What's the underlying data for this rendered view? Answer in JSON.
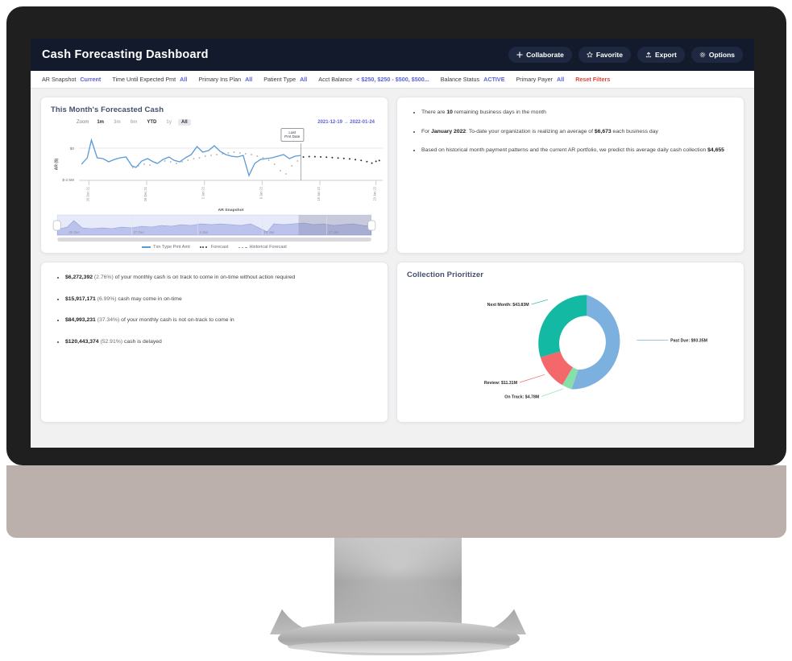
{
  "header": {
    "title": "Cash Forecasting Dashboard",
    "actions": [
      {
        "label": "Collaborate",
        "icon": "plus-icon"
      },
      {
        "label": "Favorite",
        "icon": "star-icon"
      },
      {
        "label": "Export",
        "icon": "upload-icon"
      },
      {
        "label": "Options",
        "icon": "gear-icon"
      }
    ]
  },
  "filters": [
    {
      "label": "AR Snapshot",
      "value": "Current"
    },
    {
      "label": "Time Until Expected Pmt",
      "value": "All"
    },
    {
      "label": "Primary Ins Plan",
      "value": "All"
    },
    {
      "label": "Patient Type",
      "value": "All"
    },
    {
      "label": "Acct Balance",
      "value": "< $250, $250 - $500, $500..."
    },
    {
      "label": "Balance Status",
      "value": "ACTIVE"
    },
    {
      "label": "Primary Payer",
      "value": "All"
    }
  ],
  "reset_filters": "Reset Filters",
  "forecast_card": {
    "title": "This Month's Forecasted Cash",
    "zoom_label": "Zoom",
    "zoom_options": [
      "1m",
      "3m",
      "6m",
      "YTD",
      "1y",
      "All"
    ],
    "zoom_selected": "All",
    "zoom_enabled": [
      "1m",
      "YTD",
      "All"
    ],
    "date_from": "2021-12-19",
    "date_to": "2022-01-24",
    "date_arrow": "→",
    "annotation": "Last\nPmt Date",
    "annotation_line1": "Last",
    "annotation_line2": "Pmt Date",
    "legend": [
      {
        "label": "Txn Type Pmt Amt",
        "style": "line",
        "color": "#5b9bd5"
      },
      {
        "label": "Forecast",
        "style": "dotted",
        "color": "#333333"
      },
      {
        "label": "Historical Forecast",
        "style": "dashed",
        "color": "#9a9aa2"
      }
    ],
    "navigator_ticks": [
      "20 Dec",
      "27 Dec",
      "3 Jan",
      "10 Jan",
      "17 Jan"
    ]
  },
  "chart_data": [
    {
      "type": "line",
      "title": "This Month's Forecasted Cash",
      "xlabel": "AR Snapshot",
      "ylabel": "AR ($)",
      "ytick_labels": [
        "$0",
        "$-2.5M"
      ],
      "ytick_values": [
        0,
        -2500000
      ],
      "ylim": [
        -3000000,
        1200000
      ],
      "xtick_labels": [
        "19 Dec 21",
        "26 Dec 21",
        "2 Jan 22",
        "9 Jan 22",
        "16 Jan 22",
        "23 Jan 22"
      ],
      "grid": false,
      "legend_position": "bottom",
      "annotation": "Last Pmt Date",
      "series": [
        {
          "name": "Txn Type Pmt Amt",
          "style": "line",
          "color": "#5b9bd5",
          "values": [
            -1450000,
            -150000,
            800000,
            -480000,
            -560000,
            -900000,
            -620000,
            -380000,
            -260000,
            -1100000,
            -1250000,
            -700000,
            -480000,
            -800000,
            -1000000,
            -520000,
            -320000,
            -600000,
            -700000,
            -380000,
            -160000,
            150000,
            -120000,
            -60000,
            180000,
            -80000,
            -300000,
            -420000,
            -440000,
            -380000,
            -2400000,
            -1150000,
            -760000,
            -700000,
            -640000,
            -500000,
            -360000,
            -760000,
            -380000
          ]
        },
        {
          "name": "Forecast",
          "style": "dotted",
          "color": "#333333",
          "values": [
            -80000,
            -110000,
            -140000,
            -170000,
            -200000,
            -230000,
            -260000,
            -300000,
            -340000,
            -380000,
            -420000,
            -460000,
            -510000,
            -560000,
            -620000,
            -700000,
            -560000,
            -500000
          ]
        },
        {
          "name": "Historical Forecast",
          "style": "dotted",
          "color": "#9a9aa2",
          "values": [
            -620000,
            -520000,
            -760000,
            -640000,
            -900000,
            -700000,
            -520000,
            -340000,
            -260000,
            -180000,
            -400000,
            -300000,
            -200000,
            -120000,
            -240000,
            -360000,
            -500000,
            -740000,
            -1400000,
            -2100000,
            -1500000,
            -900000,
            -560000
          ]
        }
      ]
    },
    {
      "type": "pie",
      "subtype": "donut",
      "title": "Collection Prioritizer",
      "labels": [
        "Past Due",
        "Next Month",
        "Review",
        "On Track"
      ],
      "values": [
        93.35,
        43.83,
        11.31,
        4.78
      ],
      "value_unit": "M",
      "value_prefix": "$",
      "colors": [
        "#7cb0df",
        "#13b9a3",
        "#f4686b",
        "#86e0a9"
      ],
      "data_labels": [
        "Past Due: $93.35M",
        "Next Month: $43.83M",
        "Review: $11.31M",
        "On Track: $4.78M"
      ],
      "legend_position": "callout"
    }
  ],
  "insights_card": {
    "items": [
      {
        "pre": "There are ",
        "bold": "10",
        "post": " remaining business days in the month"
      },
      {
        "pre": "For ",
        "bold": "January 2022",
        "post": ": To-date your organization is realizing an average of ",
        "bold2": "$6,673",
        "post2": " each business day"
      },
      {
        "pre": "Based on historical month payment patterns and the current AR portfolio, we predict this average daily cash collection ",
        "bold": "$4,655",
        "post": ""
      }
    ]
  },
  "breakdown_card": {
    "items": [
      {
        "amount": "$6,272,392",
        "pct": "(2.76%)",
        "text": " of your monthly cash is on track to come in on-time without action required"
      },
      {
        "amount": "$15,917,171",
        "pct": "(6.99%)",
        "text": " cash may come in on-time"
      },
      {
        "amount": "$84,993,231",
        "pct": "(37.34%)",
        "text": " of your monthly cash is not on-track to come in"
      },
      {
        "amount": "$120,443,374",
        "pct": "(52.91%)",
        "text": " cash is delayed"
      }
    ]
  },
  "prioritizer_card": {
    "title": "Collection Prioritizer"
  }
}
